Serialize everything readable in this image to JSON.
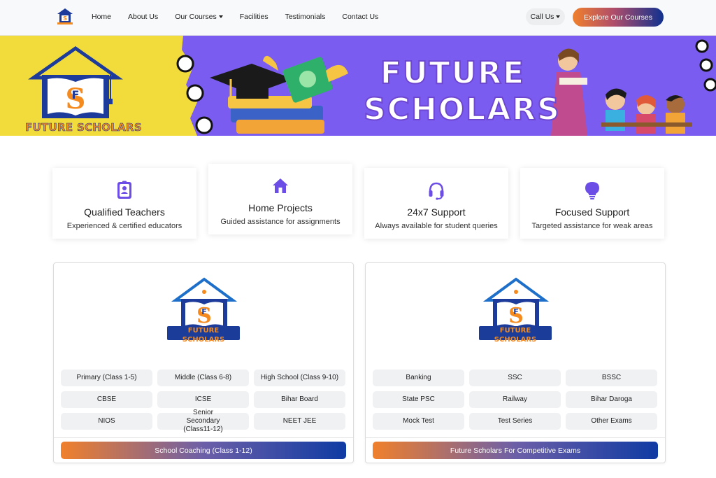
{
  "nav": {
    "links": [
      {
        "label": "Home",
        "dropdown": false
      },
      {
        "label": "About Us",
        "dropdown": false
      },
      {
        "label": "Our Courses",
        "dropdown": true
      },
      {
        "label": "Facilities",
        "dropdown": false
      },
      {
        "label": "Testimonials",
        "dropdown": false
      },
      {
        "label": "Contact Us",
        "dropdown": false
      }
    ],
    "call_label": "Call Us",
    "explore_label": "Explore Our Courses"
  },
  "banner": {
    "title_line1": "FUTURE",
    "title_line2": "SCHOLARS",
    "brand_text": "FUTURE SCHOLARS"
  },
  "features": [
    {
      "icon": "id-badge-icon",
      "title": "Qualified Teachers",
      "desc": "Experienced & certified educators"
    },
    {
      "icon": "home-icon",
      "title": "Home Projects",
      "desc": "Guided assistance for assignments"
    },
    {
      "icon": "headset-icon",
      "title": "24x7 Support",
      "desc": "Always available for student queries"
    },
    {
      "icon": "lightbulb-icon",
      "title": "Focused Support",
      "desc": "Targeted assistance for weak areas"
    }
  ],
  "courses": [
    {
      "logo_brand": "FUTURE SCHOLARS",
      "logo_tagline": "CLASSROOM AND HOME TUITION",
      "items": [
        "Primary (Class 1-5)",
        "Middle (Class 6-8)",
        "High School (Class 9-10)",
        "CBSE",
        "ICSE",
        "Bihar Board",
        "NIOS",
        "Senior Secondary (Class11-12)",
        "NEET JEE"
      ],
      "button_label": "School Coaching (Class 1-12)"
    },
    {
      "logo_brand": "FUTURE SCHOLARS",
      "logo_tagline": "CLASSROOM AND HOME TUITION",
      "items": [
        "Banking",
        "SSC",
        "BSSC",
        "State PSC",
        "Railway",
        "Bihar Daroga",
        "Mock Test",
        "Test Series",
        "Other Exams"
      ],
      "button_label": "Future Scholars For Competitive Exams"
    }
  ],
  "colors": {
    "accent_purple": "#6c4ee6",
    "banner_purple": "#7b5cf0",
    "banner_yellow": "#f1dc3b",
    "orange": "#f0802c",
    "navy": "#10318f"
  }
}
